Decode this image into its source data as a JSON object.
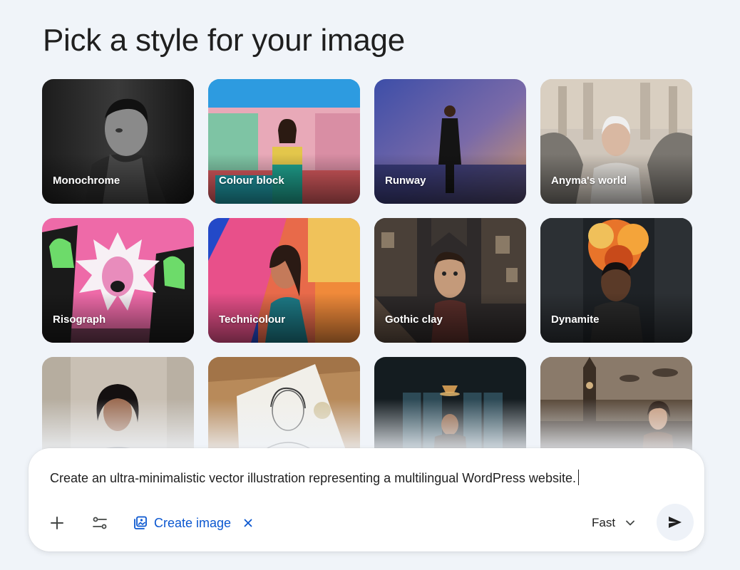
{
  "page": {
    "title": "Pick a style for your image"
  },
  "styles": [
    {
      "label": "Monochrome",
      "icon": "portrait-monochrome"
    },
    {
      "label": "Colour block",
      "icon": "portrait-colour-block"
    },
    {
      "label": "Runway",
      "icon": "portrait-runway"
    },
    {
      "label": "Anyma's world",
      "icon": "portrait-cyborg"
    },
    {
      "label": "Risograph",
      "icon": "portrait-risograph"
    },
    {
      "label": "Technicolour",
      "icon": "portrait-technicolour"
    },
    {
      "label": "Gothic clay",
      "icon": "portrait-gothic-clay"
    },
    {
      "label": "Dynamite",
      "icon": "portrait-dynamite"
    },
    {
      "label": "",
      "icon": "portrait-studio"
    },
    {
      "label": "",
      "icon": "portrait-sketch"
    },
    {
      "label": "",
      "icon": "portrait-noir"
    },
    {
      "label": "",
      "icon": "portrait-steampunk"
    }
  ],
  "composer": {
    "prompt": "Create an ultra-minimalistic vector illustration representing a multilingual WordPress website.",
    "tool_chip": "Create image",
    "mode": "Fast",
    "icons": {
      "add": "plus-icon",
      "tools": "sliders-icon",
      "chip": "image-stack-icon",
      "close": "close-icon",
      "mode": "chevron-down-icon",
      "send": "send-icon"
    }
  },
  "colors": {
    "accent": "#0b57d0",
    "background": "#f0f4f9",
    "surface": "#ffffff"
  }
}
